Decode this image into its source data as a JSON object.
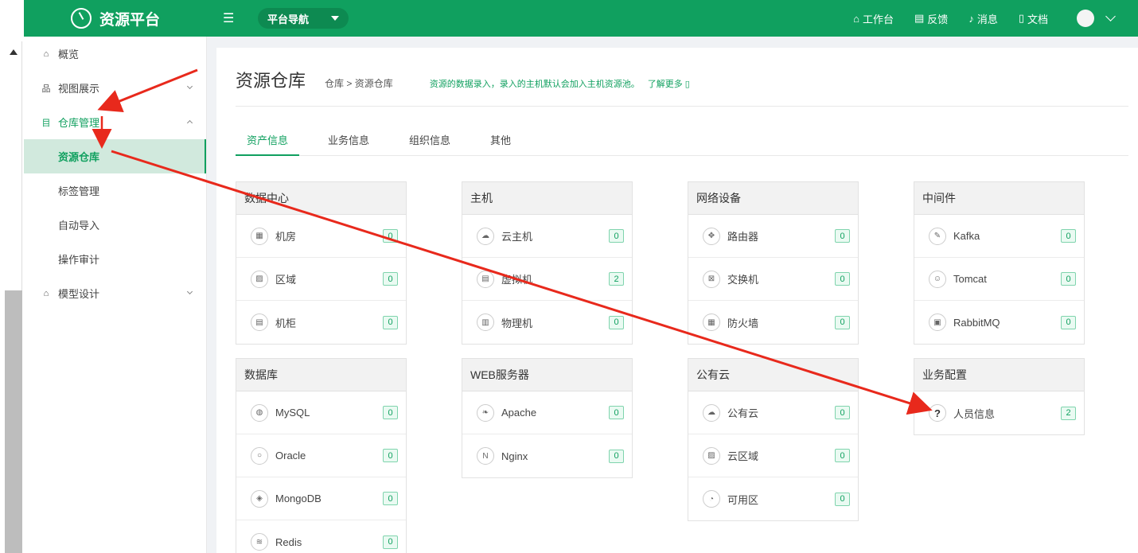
{
  "header": {
    "brand": "资源平台",
    "nav_select": "平台导航",
    "links": [
      {
        "label": "工作台",
        "icon": "home-icon"
      },
      {
        "label": "反馈",
        "icon": "feedback-icon"
      },
      {
        "label": "消息",
        "icon": "bell-icon"
      },
      {
        "label": "文档",
        "icon": "document-icon"
      }
    ]
  },
  "sidebar": {
    "overview": "概览",
    "view": "视图展示",
    "warehouse": "仓库管理",
    "sub": {
      "resource": "资源仓库",
      "tags": "标签管理",
      "import": "自动导入",
      "audit": "操作审计"
    },
    "model": "模型设计"
  },
  "main": {
    "title": "资源仓库",
    "breadcrumb": "仓库 > 资源仓库",
    "tip": "资源的数据录入，录入的主机默认会加入主机资源池。",
    "tip_link": "了解更多 ▯",
    "tabs": [
      "资产信息",
      "业务信息",
      "组织信息",
      "其他"
    ]
  },
  "cards": {
    "datacenter": {
      "title": "数据中心",
      "rows": [
        {
          "label": "机房",
          "count": "0"
        },
        {
          "label": "区域",
          "count": "0"
        },
        {
          "label": "机柜",
          "count": "0"
        }
      ]
    },
    "host": {
      "title": "主机",
      "rows": [
        {
          "label": "云主机",
          "count": "0"
        },
        {
          "label": "虚拟机",
          "count": "2"
        },
        {
          "label": "物理机",
          "count": "0"
        }
      ]
    },
    "network": {
      "title": "网络设备",
      "rows": [
        {
          "label": "路由器",
          "count": "0"
        },
        {
          "label": "交换机",
          "count": "0"
        },
        {
          "label": "防火墙",
          "count": "0"
        }
      ]
    },
    "middleware": {
      "title": "中间件",
      "rows": [
        {
          "label": "Kafka",
          "count": "0"
        },
        {
          "label": "Tomcat",
          "count": "0"
        },
        {
          "label": "RabbitMQ",
          "count": "0"
        }
      ]
    },
    "database": {
      "title": "数据库",
      "rows": [
        {
          "label": "MySQL",
          "count": "0"
        },
        {
          "label": "Oracle",
          "count": "0"
        },
        {
          "label": "MongoDB",
          "count": "0"
        },
        {
          "label": "Redis",
          "count": "0"
        }
      ]
    },
    "web": {
      "title": "WEB服务器",
      "rows": [
        {
          "label": "Apache",
          "count": "0"
        },
        {
          "label": "Nginx",
          "count": "0"
        }
      ]
    },
    "cloud": {
      "title": "公有云",
      "rows": [
        {
          "label": "公有云",
          "count": "0"
        },
        {
          "label": "云区域",
          "count": "0"
        },
        {
          "label": "可用区",
          "count": "0"
        }
      ]
    },
    "business": {
      "title": "业务配置",
      "rows": [
        {
          "label": "人员信息",
          "count": "2"
        }
      ]
    }
  },
  "colors": {
    "brand": "#10a05f",
    "annotation_arrow": "#e8291c"
  }
}
